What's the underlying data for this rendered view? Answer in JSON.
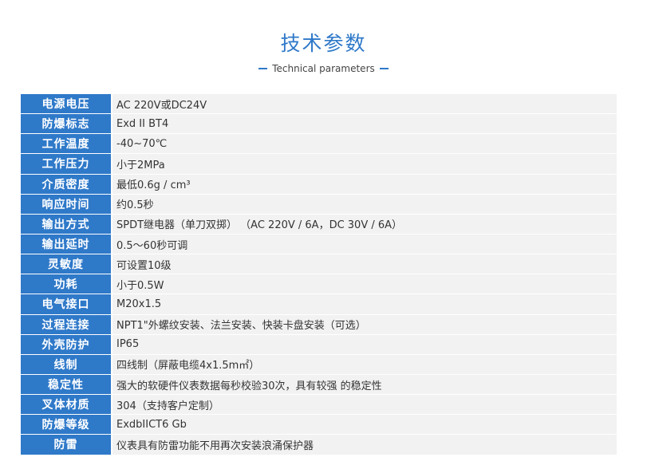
{
  "header": {
    "title": "技术参数",
    "subtitle": "Technical parameters"
  },
  "params": [
    {
      "label": "电源电压",
      "value": "AC 220V或DC24V"
    },
    {
      "label": "防爆标志",
      "value": "Exd II BT4"
    },
    {
      "label": "工作温度",
      "value": "-40~70℃"
    },
    {
      "label": "工作压力",
      "value": "小于2MPa"
    },
    {
      "label": "介质密度",
      "value": "最低0.6g / cm³"
    },
    {
      "label": "响应时间",
      "value": "约0.5秒"
    },
    {
      "label": "输出方式",
      "value": "SPDT继电器（单刀双掷） （AC 220V / 6A，DC 30V / 6A）"
    },
    {
      "label": "输出延时",
      "value": "0.5～60秒可调"
    },
    {
      "label": "灵敏度",
      "value": "可设置10级"
    },
    {
      "label": "功耗",
      "value": "小于0.5W"
    },
    {
      "label": "电气接口",
      "value": " M20x1.5"
    },
    {
      "label": "过程连接",
      "value": "NPT1\"外螺纹安装、法兰安装、快装卡盘安装（可选）"
    },
    {
      "label": "外壳防护",
      "value": "IP65"
    },
    {
      "label": "线制",
      "value": "四线制（屏蔽电缆4x1.5m㎡）"
    },
    {
      "label": "稳定性",
      "value": "强大的软硬件仪表数据每秒校验30次，具有较强  的稳定性"
    },
    {
      "label": "叉体材质",
      "value": "304（支持客户定制）"
    },
    {
      "label": "防爆等级",
      "value": "ExdbIICT6  Gb"
    },
    {
      "label": "防雷",
      "value": "仪表具有防雷功能不用再次安装浪涌保护器"
    }
  ],
  "colors": {
    "accent": "#2f79c9",
    "row_bg": "#f2f2f2"
  }
}
